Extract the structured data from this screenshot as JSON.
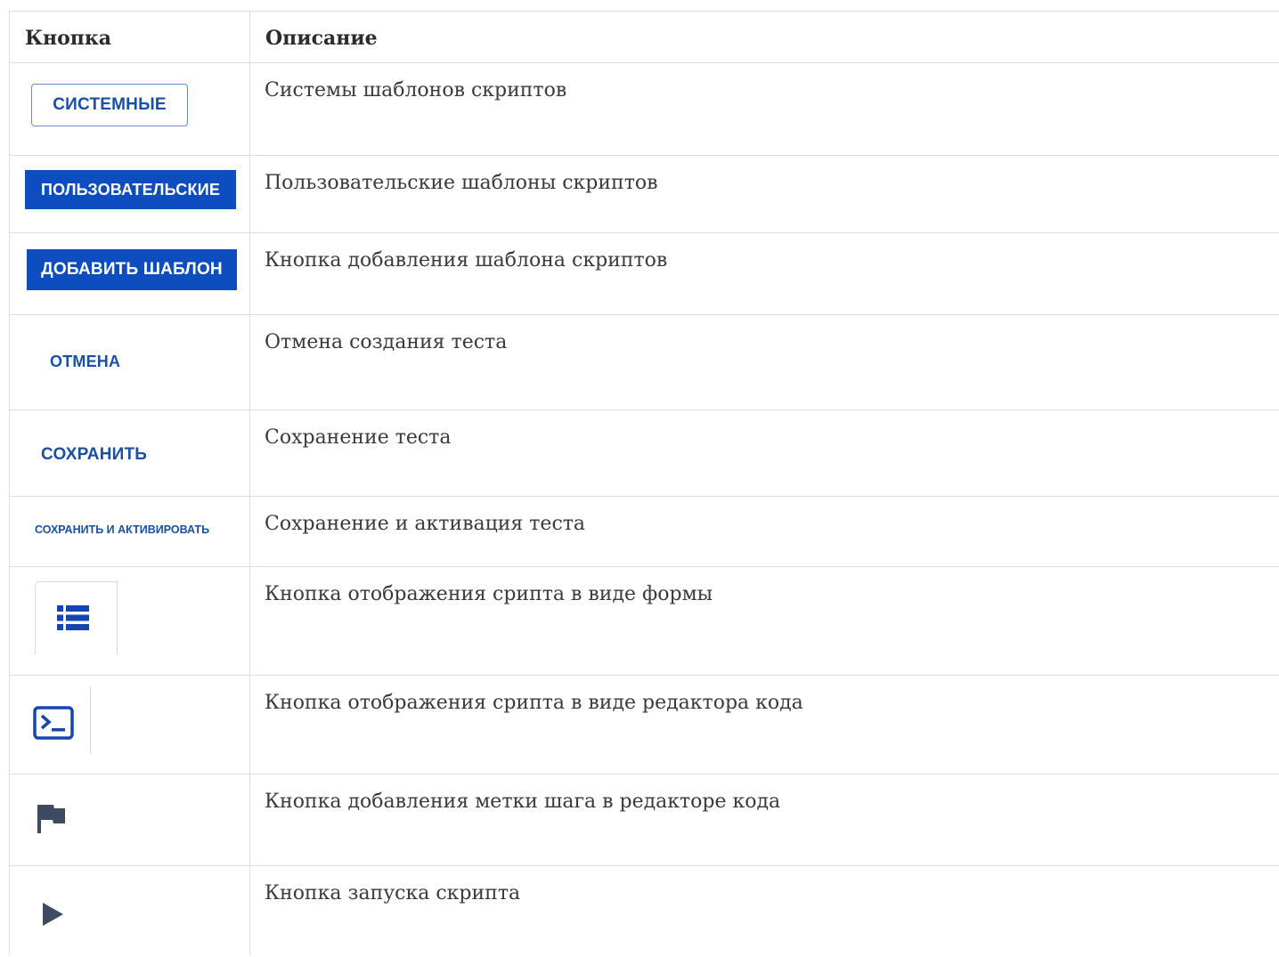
{
  "table": {
    "headers": {
      "button": "Кнопка",
      "description": "Описание"
    },
    "rows": [
      {
        "button_label": "СИСТЕМНЫЕ",
        "description": "Системы шаблонов скриптов"
      },
      {
        "button_label": "ПОЛЬЗОВАТЕЛЬСКИЕ",
        "description": "Пользовательские шаблоны скриптов"
      },
      {
        "button_label": "ДОБАВИТЬ ШАБЛОН",
        "description": "Кнопка добавления шаблона скриптов"
      },
      {
        "button_label": "ОТМЕНА",
        "description": "Отмена создания теста"
      },
      {
        "button_label": "СОХРАНИТЬ",
        "description": "Сохранение теста"
      },
      {
        "button_label": "СОХРАНИТЬ И АКТИВИРОВАТЬ",
        "description": "Сохранение и активация теста"
      },
      {
        "icon": "list-icon",
        "description": "Кнопка отображения срипта в виде формы"
      },
      {
        "icon": "terminal-icon",
        "description": "Кнопка отображения срипта в виде редактора кода"
      },
      {
        "icon": "flag-icon",
        "description": "Кнопка добавления метки шага в редакторе кода"
      },
      {
        "icon": "play-icon",
        "description": "Кнопка запуска скрипта"
      }
    ]
  },
  "colors": {
    "primary": "#0d4dbf",
    "primary_text": "#1a4fa8",
    "icon_dark": "#3e4a5f",
    "border": "#dddddd"
  }
}
